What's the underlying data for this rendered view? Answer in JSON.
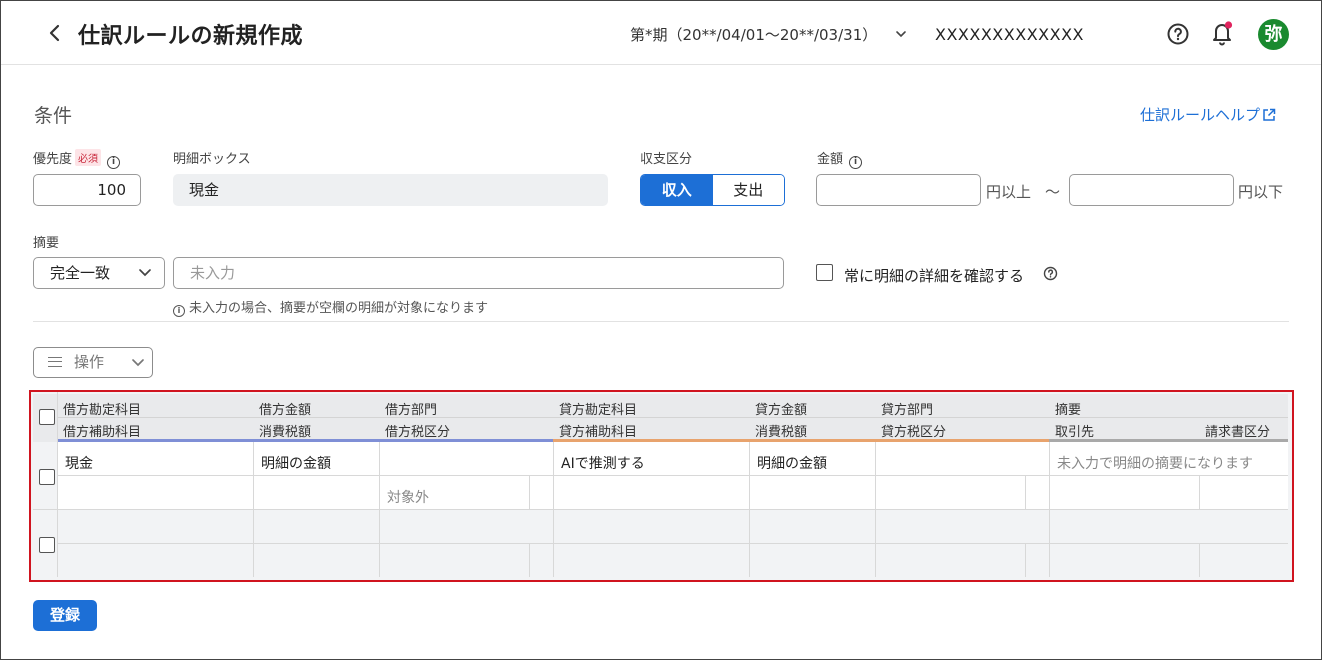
{
  "header": {
    "title": "仕訳ルールの新規作成",
    "period": "第*期（20**/04/01〜20**/03/31）",
    "company": "XXXXXXXXXXXXX",
    "avatar": "弥",
    "avatar_color": "#1a8a2f"
  },
  "conditions": {
    "section_title": "条件",
    "help_link": "仕訳ルールヘルプ",
    "priority_label": "優先度",
    "required_badge": "必須",
    "priority_value": "100",
    "box_label": "明細ボックス",
    "box_value": "現金",
    "type_label": "収支区分",
    "type_options": [
      "収入",
      "支出"
    ],
    "type_selected": "収入",
    "amount_label": "金額",
    "amount_min": "",
    "amount_max": "",
    "unit_above": "円以上",
    "range_sep": "〜",
    "unit_below": "円以下",
    "summary_label": "摘要",
    "match_type": "完全一致",
    "summary_placeholder": "未入力",
    "summary_hint": "未入力の場合、摘要が空欄の明細が対象になります",
    "always_confirm_label": "常に明細の詳細を確認する"
  },
  "operations_label": "操作",
  "table": {
    "headers_row1": [
      "借方勘定科目",
      "借方金額",
      "借方部門",
      "貸方勘定科目",
      "貸方金額",
      "貸方部門",
      "摘要"
    ],
    "headers_row2": [
      "借方補助科目",
      "消費税額",
      "借方税区分",
      "貸方補助科目",
      "消費税額",
      "貸方税区分",
      "取引先",
      "請求書区分"
    ],
    "row1_top": [
      "現金",
      "明細の金額",
      "",
      "AIで推測する",
      "明細の金額",
      "",
      "未入力で明細の摘要になります"
    ],
    "row1_bottom": [
      "",
      "",
      "対象外",
      "",
      "",
      "",
      "",
      ""
    ],
    "debit_color": "#7f8fd6",
    "credit_color": "#e8a36d",
    "other_color": "#a9a9a9"
  },
  "register_label": "登録"
}
